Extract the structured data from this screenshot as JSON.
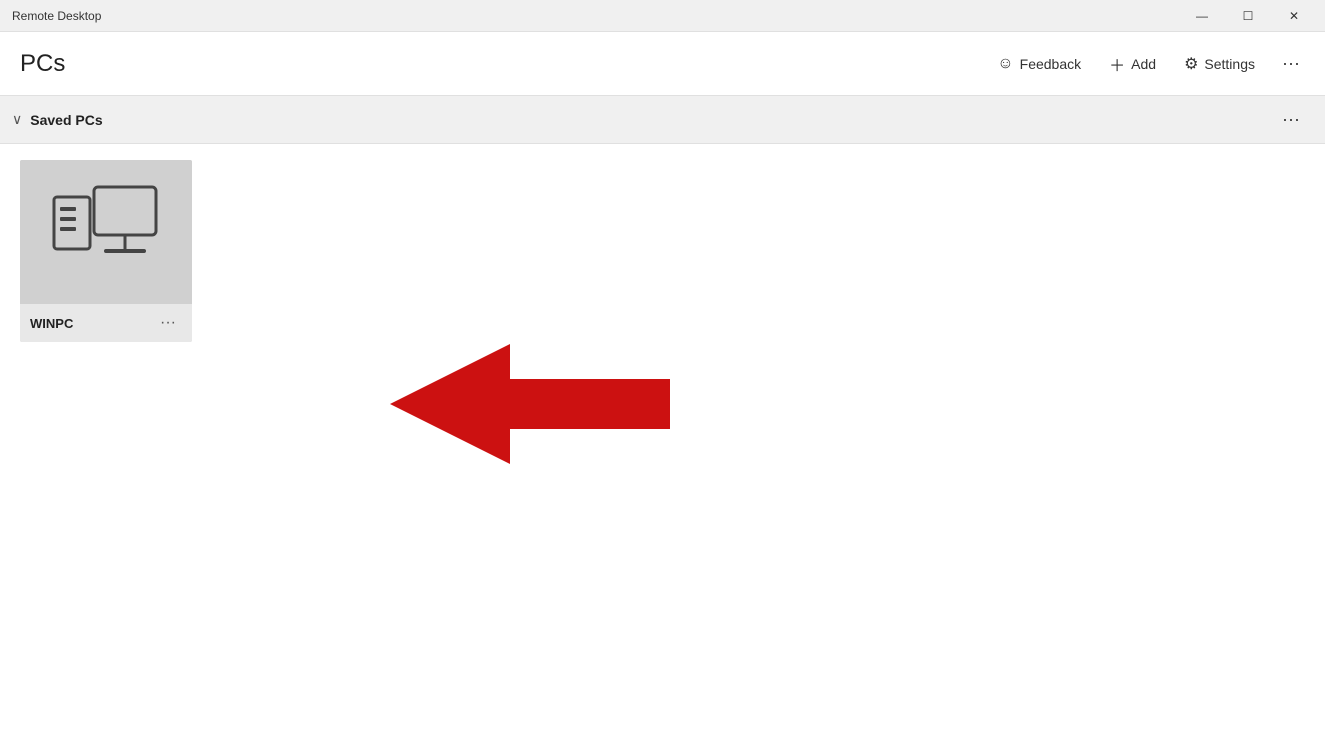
{
  "titlebar": {
    "title": "Remote Desktop",
    "minimize_label": "—",
    "maximize_label": "☐",
    "close_label": "✕"
  },
  "header": {
    "title": "PCs",
    "feedback_label": "Feedback",
    "add_label": "Add",
    "settings_label": "Settings",
    "more_label": "···"
  },
  "saved_pcs": {
    "section_title": "Saved PCs",
    "more_label": "···",
    "chevron": "∨"
  },
  "pc_tile": {
    "name": "WINPC",
    "more_label": "···"
  },
  "colors": {
    "arrow_red": "#cc1111"
  }
}
